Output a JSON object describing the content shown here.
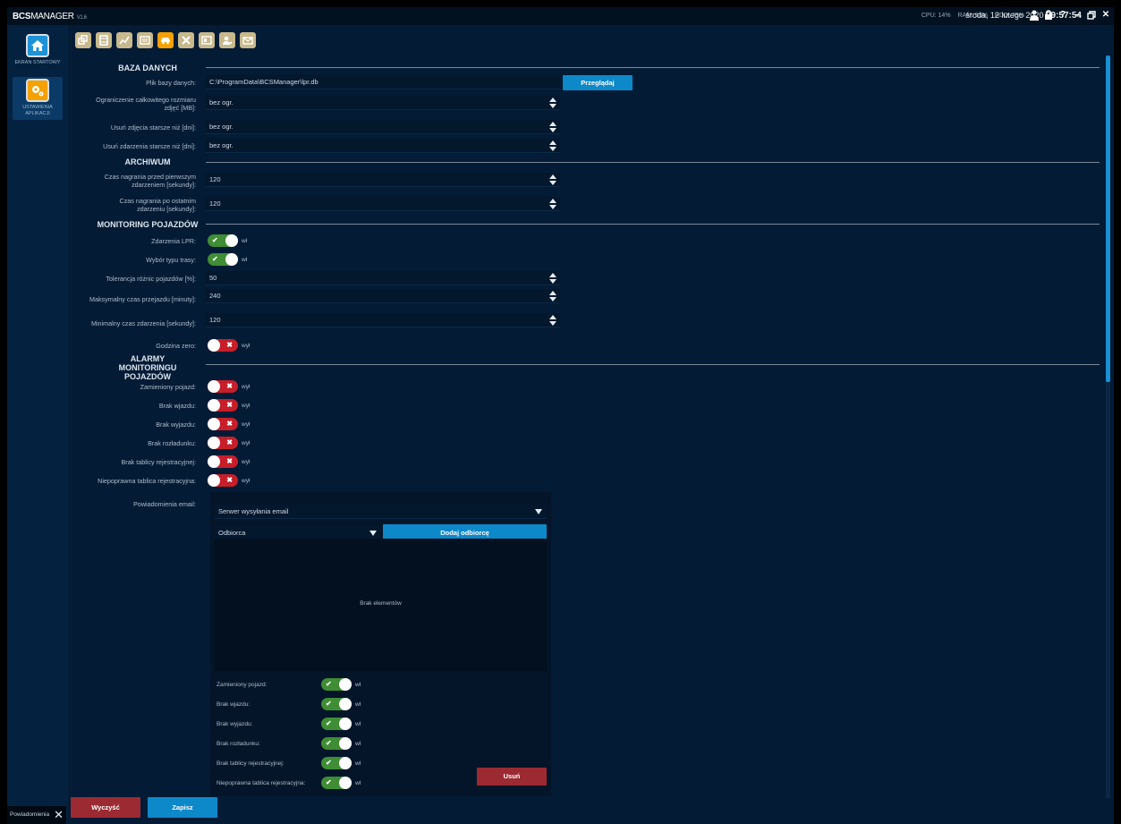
{
  "app": {
    "brand_bold": "BCS",
    "brand_thin": "MANAGER",
    "version": "V1.6",
    "cpu": "CPU: 14%",
    "ram": "RAM: 53%",
    "hdd": "HDD: 79%",
    "date": "środa, 12 lutego 2020",
    "time": "09:57:54"
  },
  "sidebar": {
    "items": [
      {
        "label": "EKRAN STARTOWY",
        "icon": "home-icon"
      },
      {
        "label": "USTAWIENIA APLIKACJI",
        "icon": "gears-icon"
      }
    ]
  },
  "toolbar": {
    "icons": [
      "windows-icon",
      "film-icon",
      "chart-icon",
      "list-icon",
      "car-icon",
      "tools-icon",
      "panel-icon",
      "user-key-icon",
      "mail-icon"
    ],
    "active": "car-icon"
  },
  "baza": {
    "title": "BAZA DANYCH",
    "plik_label": "Plik bazy danych:",
    "plik_value": "C:\\ProgramData\\BCSManager\\lpr.db",
    "browse": "Przeglądaj",
    "limit_label": "Ograniczenie całkowitego rozmiaru zdjęć [MB]:",
    "limit_value": "bez ogr.",
    "photos_label": "Usuń zdjęcia starsze niż [dni]:",
    "photos_value": "bez ogr.",
    "events_label": "Usuń zdarzenia starsze niż [dni]:",
    "events_value": "bez ogr."
  },
  "archiwum": {
    "title": "ARCHIWUM",
    "before_label": "Czas nagrania przed pierwszym zdarzeniem [sekundy]:",
    "before_value": "120",
    "after_label": "Czas nagrania po ostatnim zdarzeniu [sekundy]:",
    "after_value": "120"
  },
  "monitoring": {
    "title": "MONITORING POJAZDÓW",
    "lpr_label": "Zdarzenia LPR:",
    "lpr_state": "wł",
    "route_label": "Wybór typu trasy:",
    "route_state": "wł",
    "tol_label": "Tolerancja różnic pojazdów [%]:",
    "tol_value": "50",
    "maxtime_label": "Maksymalny czas przejazdu [minuty]:",
    "maxtime_value": "240",
    "mintime_label": "Minimalny czas zdarzenia [sekundy]:",
    "mintime_value": "120",
    "zero_label": "Godzina zero:",
    "zero_state": "wył"
  },
  "alarmy": {
    "title": "ALARMY MONITORINGU POJAZDÓW",
    "items": [
      {
        "label": "Zamieniony pojazd:",
        "state": "wył"
      },
      {
        "label": "Brak wjazdu:",
        "state": "wył"
      },
      {
        "label": "Brak wyjazdu:",
        "state": "wył"
      },
      {
        "label": "Brak rozładunku:",
        "state": "wył"
      },
      {
        "label": "Brak tablicy rejestracyjnej:",
        "state": "wył"
      },
      {
        "label": "Niepoprawna tablica rejestracyjna:",
        "state": "wył"
      }
    ]
  },
  "email": {
    "label": "Powiadomienia email:",
    "server": "Serwer wysyłania email",
    "recipient": "Odbiorca",
    "add": "Dodaj odbiorcę",
    "empty": "Brak elementów",
    "items": [
      {
        "label": "Zamieniony pojazd:",
        "state": "wł"
      },
      {
        "label": "Brak wjazdu:",
        "state": "wł"
      },
      {
        "label": "Brak wyjazdu:",
        "state": "wł"
      },
      {
        "label": "Brak rozładunku:",
        "state": "wł"
      },
      {
        "label": "Brak tablicy rejestracyjnej:",
        "state": "wł"
      },
      {
        "label": "Niepoprawna tablica rejestracyjna:",
        "state": "wł"
      }
    ],
    "delete": "Usuń"
  },
  "footer": {
    "notifications": "Powiadomienia",
    "clear": "Wyczyść",
    "save": "Zapisz"
  },
  "colors": {
    "accent_blue": "#0d88c9",
    "toggle_on": "#3f8d34",
    "toggle_off": "#c71e2a",
    "active_tool": "#f5a100"
  }
}
